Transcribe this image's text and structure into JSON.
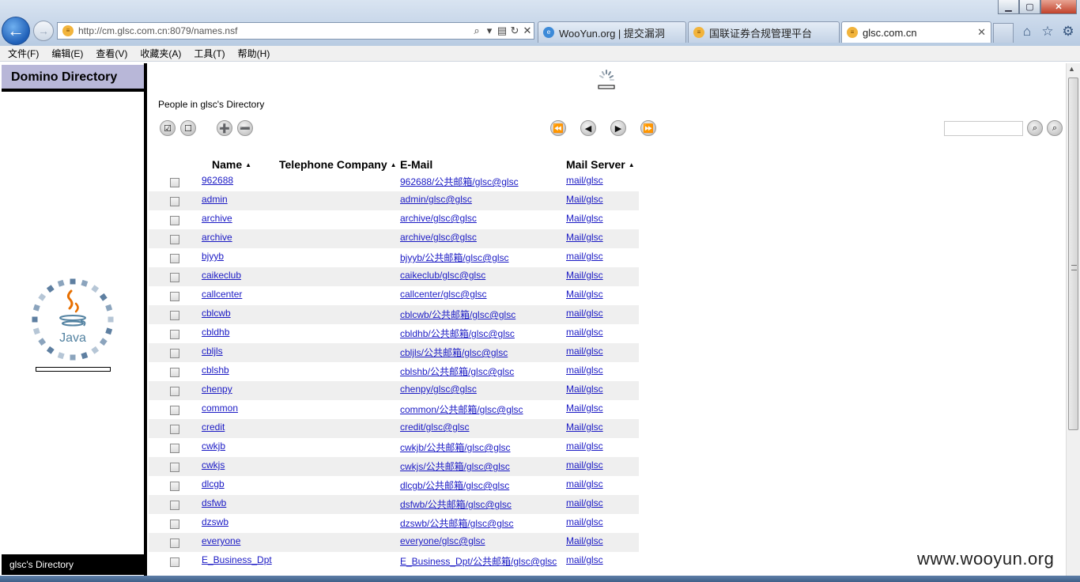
{
  "browser": {
    "url": "http://cm.glsc.com.cn:8079/names.nsf",
    "tabs": [
      {
        "label": "WooYun.org | 提交漏洞",
        "icon": "ie-icon"
      },
      {
        "label": "国联证券合规管理平台",
        "icon": "site-icon"
      },
      {
        "label": "glsc.com.cn",
        "icon": "site-icon",
        "active": true
      }
    ],
    "window_controls": {
      "minimize": "▁",
      "maximize": "▢",
      "close": "✕"
    }
  },
  "menu": [
    "文件(F)",
    "编辑(E)",
    "查看(V)",
    "收藏夹(A)",
    "工具(T)",
    "帮助(H)"
  ],
  "left_frame": {
    "header": "Domino Directory",
    "footer": "glsc's Directory",
    "java_label": "Java"
  },
  "view": {
    "title": "People in glsc's Directory",
    "columns": {
      "name": "Name",
      "phone_company": "Telephone Company",
      "email": "E-Mail",
      "mail_server": "Mail Server"
    },
    "rows": [
      {
        "name": "962688",
        "email": "962688/公共邮箱/glsc@glsc",
        "server": "mail/glsc"
      },
      {
        "name": "admin",
        "email": "admin/glsc@glsc",
        "server": "Mail/glsc"
      },
      {
        "name": "archive",
        "email": "archive/glsc@glsc",
        "server": "Mail/glsc"
      },
      {
        "name": "archive",
        "email": "archive/glsc@glsc",
        "server": "Mail/glsc"
      },
      {
        "name": "bjyyb",
        "email": "bjyyb/公共邮箱/glsc@glsc",
        "server": "mail/glsc"
      },
      {
        "name": "caikeclub",
        "email": "caikeclub/glsc@glsc",
        "server": "Mail/glsc"
      },
      {
        "name": "callcenter",
        "email": "callcenter/glsc@glsc",
        "server": "Mail/glsc"
      },
      {
        "name": "cblcwb",
        "email": "cblcwb/公共邮箱/glsc@glsc",
        "server": "mail/glsc"
      },
      {
        "name": "cbldhb",
        "email": "cbldhb/公共邮箱/glsc@glsc",
        "server": "mail/glsc"
      },
      {
        "name": "cbljls",
        "email": "cbljls/公共邮箱/glsc@glsc",
        "server": "mail/glsc"
      },
      {
        "name": "cblshb",
        "email": "cblshb/公共邮箱/glsc@glsc",
        "server": "mail/glsc"
      },
      {
        "name": "chenpy",
        "email": "chenpy/glsc@glsc",
        "server": "Mail/glsc"
      },
      {
        "name": "common",
        "email": "common/公共邮箱/glsc@glsc",
        "server": "Mail/glsc"
      },
      {
        "name": "credit",
        "email": "credit/glsc@glsc",
        "server": "Mail/glsc"
      },
      {
        "name": "cwkjb",
        "email": "cwkjb/公共邮箱/glsc@glsc",
        "server": "mail/glsc"
      },
      {
        "name": "cwkjs",
        "email": "cwkjs/公共邮箱/glsc@glsc",
        "server": "mail/glsc"
      },
      {
        "name": "dlcgb",
        "email": "dlcgb/公共邮箱/glsc@glsc",
        "server": "mail/glsc"
      },
      {
        "name": "dsfwb",
        "email": "dsfwb/公共邮箱/glsc@glsc",
        "server": "mail/glsc"
      },
      {
        "name": "dzswb",
        "email": "dzswb/公共邮箱/glsc@glsc",
        "server": "mail/glsc"
      },
      {
        "name": "everyone",
        "email": "everyone/glsc@glsc",
        "server": "Mail/glsc"
      },
      {
        "name": "E_Business_Dpt",
        "email": "E_Business_Dpt/公共邮箱/glsc@glsc",
        "server": "mail/glsc"
      }
    ]
  },
  "watermark": "www.wooyun.org",
  "colors": {
    "link": "#1a19c4",
    "header_bg": "#b8b7d8",
    "row_alt": "#efefef"
  }
}
